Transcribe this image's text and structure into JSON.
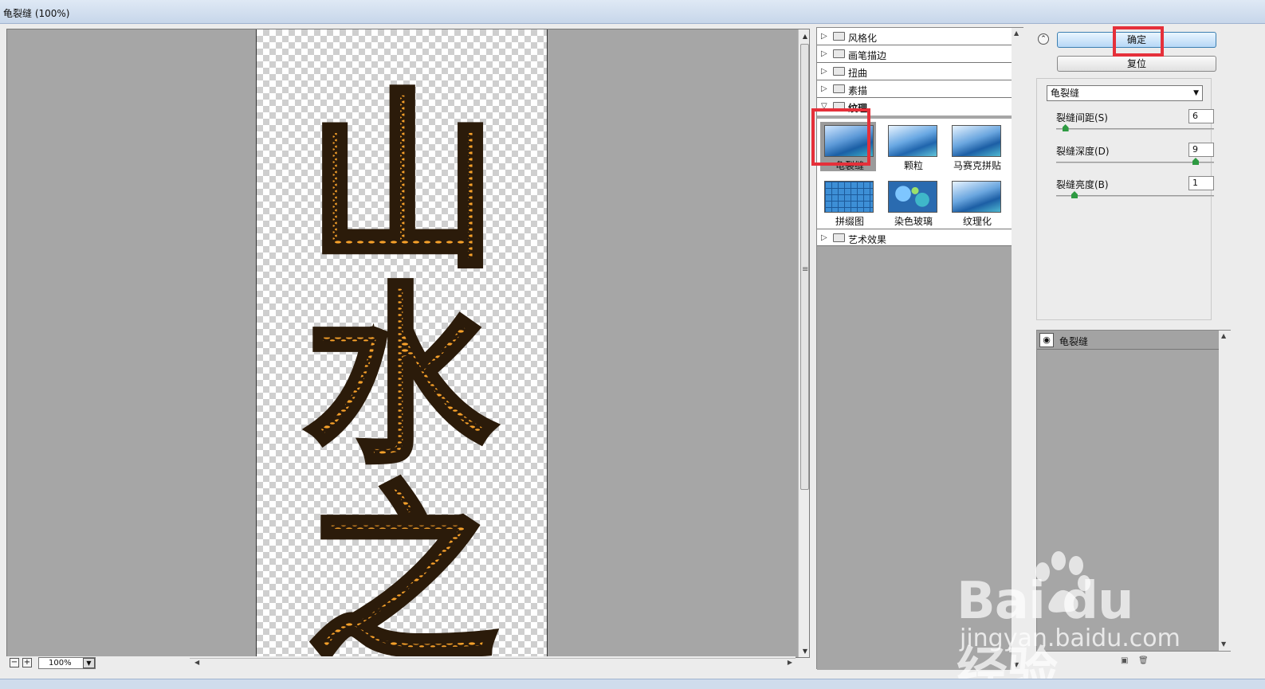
{
  "window": {
    "title": "龟裂缝 (100%)"
  },
  "preview": {
    "zoom": "100%",
    "zoom_out": "−",
    "zoom_in": "+",
    "chars": [
      "山",
      "水",
      "之"
    ],
    "colors": {
      "fill": "#2b1b0a",
      "crack": "#f7a12a",
      "bg": "#a6a6a6"
    }
  },
  "gallery": {
    "categories": [
      {
        "label": "风格化"
      },
      {
        "label": "画笔描边"
      },
      {
        "label": "扭曲"
      },
      {
        "label": "素描"
      },
      {
        "label": "纹理"
      },
      {
        "label": "艺术效果"
      }
    ],
    "texture_filters": [
      {
        "label": "龟裂缝",
        "selected": true
      },
      {
        "label": "颗粒"
      },
      {
        "label": "马赛克拼贴"
      },
      {
        "label": "拼缀图"
      },
      {
        "label": "染色玻璃"
      },
      {
        "label": "纹理化"
      }
    ]
  },
  "buttons": {
    "ok": "确定",
    "reset": "复位"
  },
  "settings": {
    "filter_select": "龟裂缝",
    "params": [
      {
        "label": "裂缝间距(S)",
        "value": "6",
        "fraction": 0.04
      },
      {
        "label": "裂缝深度(D)",
        "value": "9",
        "fraction": 0.9
      },
      {
        "label": "裂缝亮度(B)",
        "value": "1",
        "fraction": 0.1
      }
    ]
  },
  "layers": [
    {
      "label": "龟裂缝"
    }
  ],
  "watermark": {
    "brand": "Bai du 经验",
    "url": "jingyan.baidu.com"
  }
}
